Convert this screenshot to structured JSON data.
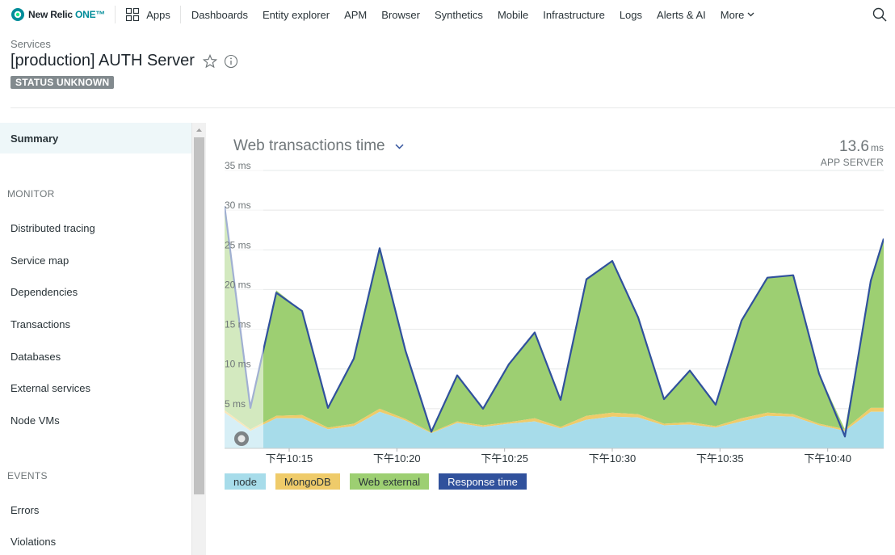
{
  "nav": {
    "logo_text": "New Relic",
    "logo_one": "ONE™",
    "apps_label": "Apps",
    "items": [
      "Dashboards",
      "Entity explorer",
      "APM",
      "Browser",
      "Synthetics",
      "Mobile",
      "Infrastructure",
      "Logs",
      "Alerts & AI"
    ],
    "more_label": "More"
  },
  "header": {
    "breadcrumb": "Services",
    "title": "[production] AUTH Server",
    "status": "STATUS UNKNOWN"
  },
  "sidebar": {
    "summary": "Summary",
    "monitor_heading": "MONITOR",
    "monitor_items": [
      "Distributed tracing",
      "Service map",
      "Dependencies",
      "Transactions",
      "Databases",
      "External services",
      "Node VMs"
    ],
    "events_heading": "EVENTS",
    "events_items": [
      "Errors",
      "Violations"
    ]
  },
  "chart": {
    "title": "Web transactions time",
    "summary_value": "13.6",
    "summary_unit": "ms",
    "summary_label": "APP SERVER"
  },
  "colors": {
    "node": "#a7dcea",
    "mongodb": "#efcb6a",
    "web_external": "#9dcf72",
    "response_time": "#30519c"
  },
  "chart_data": {
    "type": "area",
    "stacked": true,
    "ylim": [
      0,
      35
    ],
    "yticks": [
      "35 ms",
      "30 ms",
      "25 ms",
      "20 ms",
      "15 ms",
      "10 ms",
      "5 ms"
    ],
    "xticks": [
      "下午10:15",
      "下午10:20",
      "下午10:25",
      "下午10:30",
      "下午10:35",
      "下午10:40"
    ],
    "x_unit": "minutes",
    "xrange": [
      10.2,
      10.71
    ],
    "x": [
      10.2,
      10.22,
      10.24,
      10.26,
      10.28,
      10.3,
      10.32,
      10.34,
      10.36,
      10.38,
      10.4,
      10.42,
      10.44,
      10.46,
      10.48,
      10.5,
      10.52,
      10.54,
      10.56,
      10.58,
      10.6,
      10.62,
      10.64,
      10.66,
      10.68,
      10.7,
      10.71
    ],
    "grid": true,
    "legend": "bottom-left",
    "series": [
      {
        "name": "node",
        "values": [
          4.5,
          2.2,
          3.8,
          3.8,
          2.4,
          2.8,
          4.6,
          3.5,
          1.9,
          3.2,
          2.7,
          3.1,
          3.4,
          2.5,
          3.6,
          4.0,
          3.9,
          2.9,
          3.0,
          2.6,
          3.4,
          4.1,
          4.0,
          2.9,
          2.2,
          4.6,
          4.6
        ]
      },
      {
        "name": "MongoDB",
        "values": [
          0.3,
          0.2,
          0.3,
          0.4,
          0.2,
          0.3,
          0.4,
          0.2,
          0.1,
          0.2,
          0.2,
          0.2,
          0.4,
          0.2,
          0.5,
          0.5,
          0.4,
          0.2,
          0.3,
          0.2,
          0.4,
          0.4,
          0.3,
          0.2,
          0.2,
          0.5,
          0.5
        ]
      },
      {
        "name": "Web external",
        "values": [
          25.7,
          2.5,
          15.8,
          13.1,
          2.4,
          8.2,
          20.2,
          8.6,
          0.1,
          5.8,
          2.1,
          7.3,
          10.8,
          3.4,
          17.2,
          19.1,
          12.2,
          3.1,
          6.5,
          2.7,
          12.3,
          17.0,
          17.5,
          6.3,
          0.0,
          16.0,
          21.3
        ]
      },
      {
        "name": "Response time",
        "values": [
          30.5,
          5.1,
          19.6,
          17.3,
          5.1,
          11.3,
          25.2,
          12.3,
          2.1,
          9.2,
          5.0,
          10.6,
          14.6,
          6.1,
          21.3,
          23.6,
          16.5,
          6.2,
          9.8,
          5.5,
          16.1,
          21.5,
          21.8,
          9.4,
          1.5,
          21.1,
          26.4
        ]
      }
    ]
  }
}
